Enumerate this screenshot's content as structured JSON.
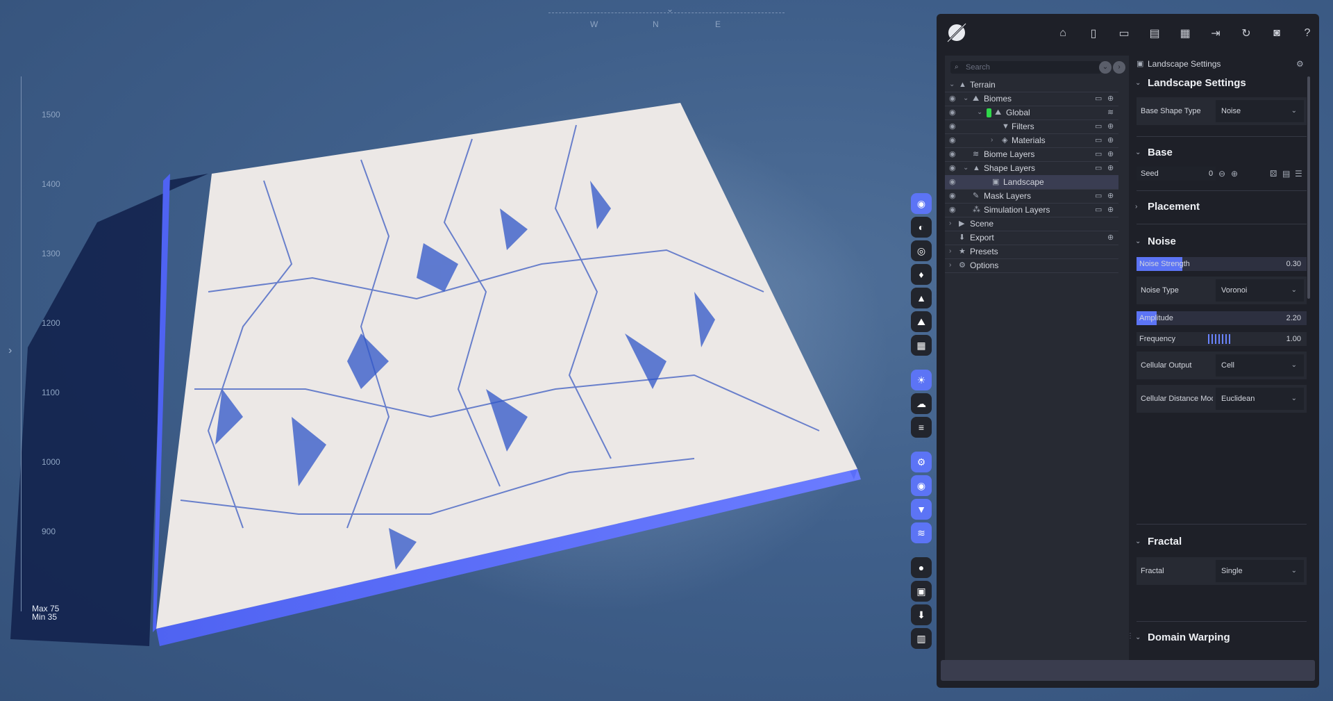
{
  "compass": {
    "w": "W",
    "n": "N",
    "e": "E"
  },
  "ruler": {
    "labels": [
      "1500",
      "1400",
      "1300",
      "1200",
      "1100",
      "1000",
      "900"
    ]
  },
  "stats": {
    "max": "Max 75",
    "min": "Min 35"
  },
  "toolbar": {
    "icons": [
      "home-icon",
      "new-file-icon",
      "open-folder-icon",
      "save-icon",
      "save-as-icon",
      "export-icon",
      "sync-icon",
      "camera-icon",
      "help-icon"
    ]
  },
  "tree": {
    "search_placeholder": "Search",
    "items": [
      {
        "label": "Terrain"
      },
      {
        "label": "Biomes"
      },
      {
        "label": "Global"
      },
      {
        "label": "Filters"
      },
      {
        "label": "Materials"
      },
      {
        "label": "Biome Layers"
      },
      {
        "label": "Shape Layers"
      },
      {
        "label": "Landscape"
      },
      {
        "label": "Mask Layers"
      },
      {
        "label": "Simulation Layers"
      },
      {
        "label": "Scene"
      },
      {
        "label": "Export"
      },
      {
        "label": "Presets"
      },
      {
        "label": "Options"
      }
    ]
  },
  "props": {
    "header": "Landscape Settings",
    "sections": {
      "landscape": "Landscape Settings",
      "base": "Base",
      "placement": "Placement",
      "noise": "Noise",
      "fractal": "Fractal",
      "domain_warping": "Domain Warping"
    },
    "base_shape_type": {
      "label": "Base Shape Type",
      "value": "Noise"
    },
    "seed": {
      "label": "Seed",
      "value": "0"
    },
    "noise_strength": {
      "label": "Noise Strength",
      "value": "0.30",
      "fraction": 0.27
    },
    "noise_type": {
      "label": "Noise Type",
      "value": "Voronoi"
    },
    "amplitude": {
      "label": "Amplitude",
      "value": "2.20",
      "fraction": 0.12
    },
    "frequency": {
      "label": "Frequency",
      "value": "1.00"
    },
    "cellular_output": {
      "label": "Cellular Output",
      "value": "Cell"
    },
    "cellular_distance": {
      "label": "Cellular Distance Mode",
      "value": "Euclidean"
    },
    "fractal": {
      "label": "Fractal",
      "value": "Single"
    }
  },
  "colors": {
    "accent": "#5c74f5",
    "panel": "#1e2028",
    "chip": "#2fd84a"
  }
}
